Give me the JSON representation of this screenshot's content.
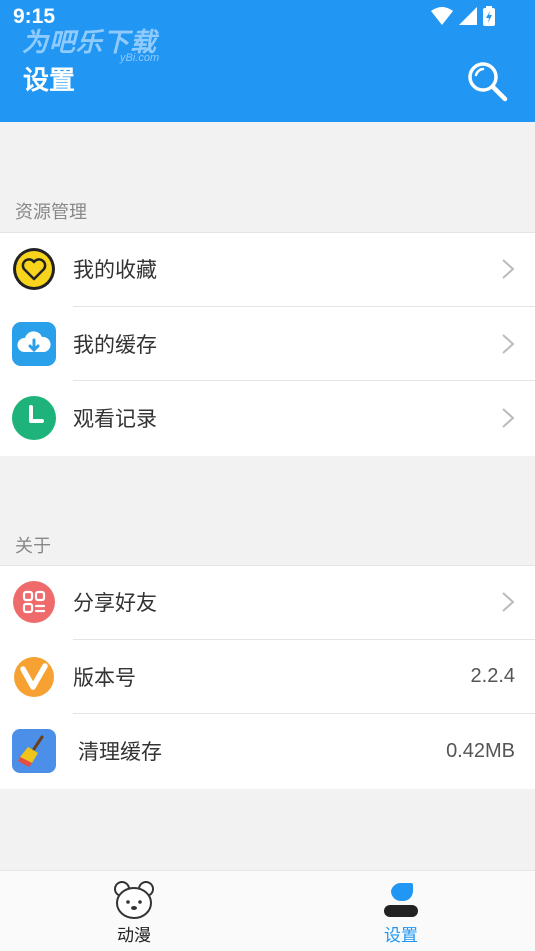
{
  "status": {
    "time": "9:15"
  },
  "watermark": {
    "text": "为吧乐下载",
    "sub": "yBi.com"
  },
  "header": {
    "title": "设置"
  },
  "sections": [
    {
      "label": "资源管理",
      "items": [
        {
          "label": "我的收藏",
          "icon": "heart-icon"
        },
        {
          "label": "我的缓存",
          "icon": "cloud-download-icon"
        },
        {
          "label": "观看记录",
          "icon": "clock-icon"
        }
      ]
    },
    {
      "label": "关于",
      "items": [
        {
          "label": "分享好友",
          "icon": "share-grid-icon"
        },
        {
          "label": "版本号",
          "value": "2.2.4",
          "icon": "v-logo-icon"
        },
        {
          "label": "清理缓存",
          "value": "0.42MB",
          "icon": "broom-icon"
        }
      ]
    }
  ],
  "bottom_nav": [
    {
      "label": "动漫",
      "icon": "bear-icon",
      "active": false
    },
    {
      "label": "设置",
      "icon": "user-icon",
      "active": true
    }
  ],
  "colors": {
    "primary": "#2196f3",
    "active_tab": "#2196f3",
    "inactive_tab": "#222222"
  }
}
